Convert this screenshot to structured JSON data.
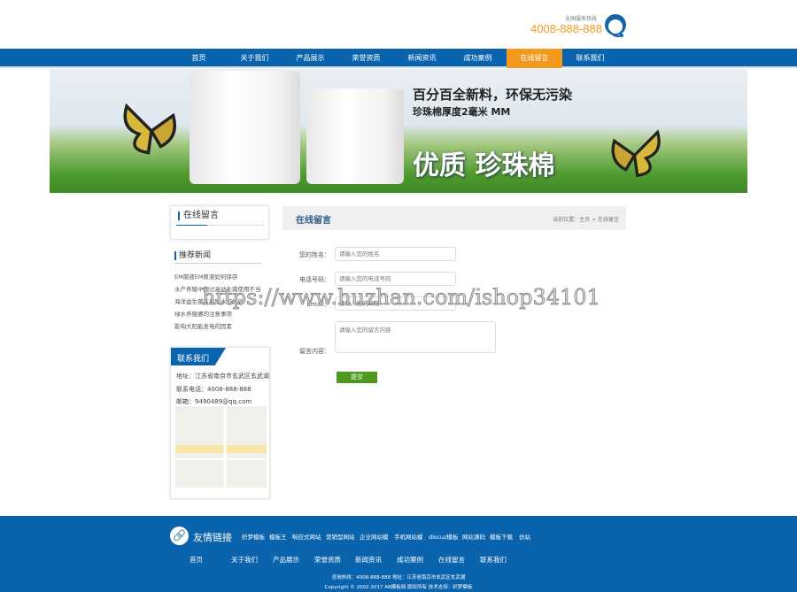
{
  "header": {
    "hotline_label": "全国服务热线",
    "hotline": "4008-888-888"
  },
  "nav": [
    {
      "label": "首页"
    },
    {
      "label": "关于我们"
    },
    {
      "label": "产品展示"
    },
    {
      "label": "荣誉资质"
    },
    {
      "label": "新闻资讯"
    },
    {
      "label": "成功案例"
    },
    {
      "label": "在线留言",
      "active": true
    },
    {
      "label": "联系我们"
    }
  ],
  "banner": {
    "line1": "百分百全新料，环保无污染",
    "line2": "珍珠棉厚度2毫米 MM",
    "big": "优质 珍珠棉"
  },
  "sidebar": {
    "section_title": "在线留言",
    "news_title": "推荐新闻",
    "news": [
      "EM菌液EM原液如何保存",
      "水产养殖中施过高益生菌使用不当",
      "海洋益生菌在养殖水的好处",
      "绿水养殖螺的注意事项",
      "影响大阳能发电的因素"
    ],
    "contact_title": "联系我们",
    "address": "地址：江苏省南京市玄武区玄武湖",
    "phone": "联系电话：4008-888-888",
    "email": "邮箱：9490489@qq.com"
  },
  "main": {
    "title": "在线留言",
    "breadcrumb": "当前位置：主页 > 在线留言",
    "form": {
      "name_label": "您的姓名：",
      "name_placeholder": "请输入您的姓名",
      "phone_label": "电话号码：",
      "phone_placeholder": "请输入您的电话号码",
      "email_label": "Email：",
      "email_placeholder": "请输入您的邮箱",
      "message_label": "留言内容：",
      "message_placeholder": "请输入您的留言内容",
      "submit": "提交"
    }
  },
  "watermark": "https://www.huzhan.com/ishop34101",
  "footer": {
    "links_title": "友情链接",
    "links": [
      "织梦模板",
      "模板王",
      "响应式网站",
      "营销型网站",
      "企业网站模",
      "手机网站模",
      "discuz模板",
      "网站源码",
      "模板下载",
      "仿站"
    ],
    "nav": [
      "首页",
      "关于我们",
      "产品展示",
      "荣誉资质",
      "新闻资讯",
      "成功案例",
      "在线留言",
      "联系我们"
    ],
    "info": "咨询热线：4008-888-888 地址：江苏省南京市玄武区玄武湖",
    "copyright": "Copyright © 2002-2017 AB模板网 版权所有 技术支持：织梦模板"
  },
  "colors": {
    "primary": "#0a64ad",
    "accent": "#f39a1e",
    "submit": "#4e9a1f"
  }
}
